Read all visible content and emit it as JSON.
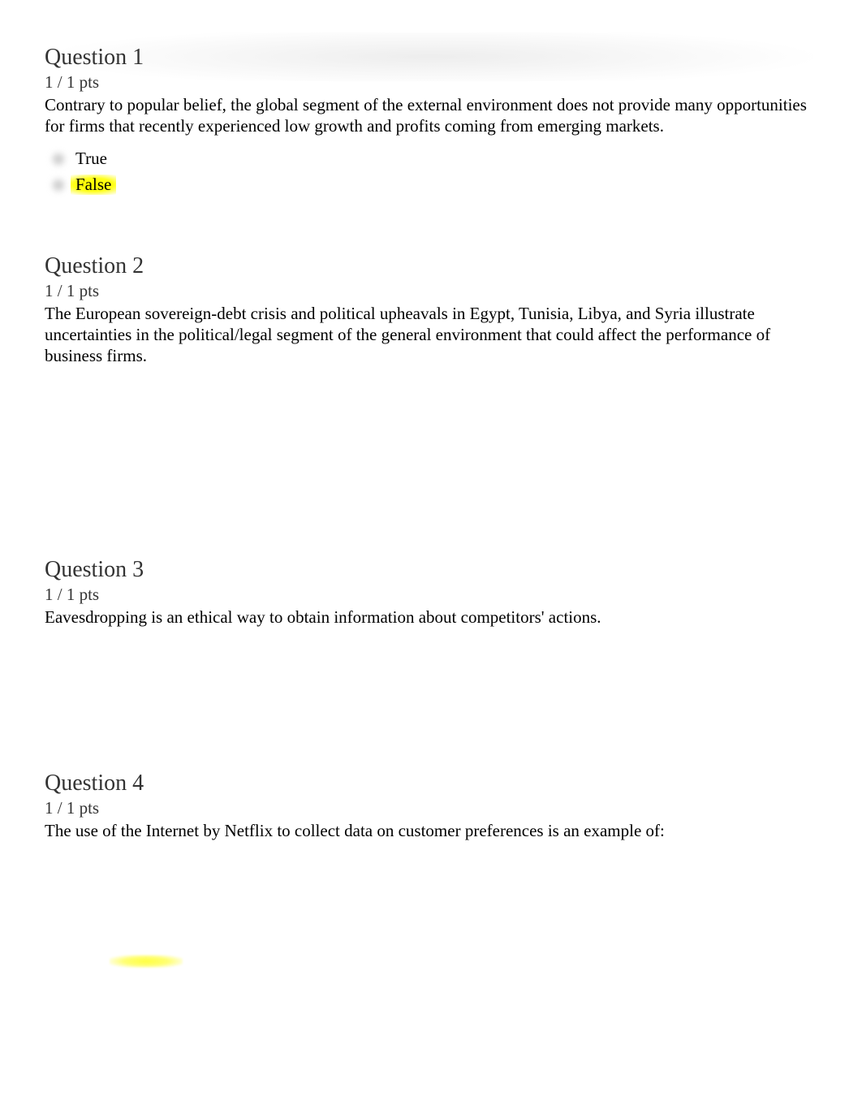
{
  "questions": [
    {
      "title": "Question 1",
      "points": "1 / 1 pts",
      "text": "Contrary to popular belief, the global segment of the external environment does not provide many opportunities for firms that recently experienced low growth and profits coming from emerging markets.",
      "answers": {
        "option_true": "True",
        "option_false": "False"
      }
    },
    {
      "title": "Question 2",
      "points": "1 / 1 pts",
      "text": "The European sovereign-debt crisis and political upheavals in Egypt, Tunisia, Libya, and Syria illustrate uncertainties in the political/legal segment of the general environment that could affect the performance of business firms."
    },
    {
      "title": "Question 3",
      "points": "1 / 1 pts",
      "text": "Eavesdropping is an ethical way to obtain information about competitors' actions."
    },
    {
      "title": "Question 4",
      "points": "1 / 1 pts",
      "text": "The use of the Internet by Netflix to collect data on customer preferences is an example of:"
    }
  ]
}
